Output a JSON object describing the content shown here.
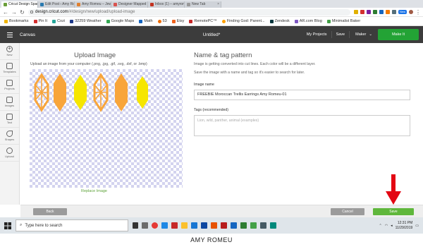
{
  "browser": {
    "tabs": [
      {
        "title": "Cricut Design Space",
        "active": true
      },
      {
        "title": "Edit Post ‹ Amy Romeu"
      },
      {
        "title": "Amy Romeu – Jewelry Ma"
      },
      {
        "title": "Designer Mapped Online"
      },
      {
        "title": "Inbox (1) – amyromeu@g"
      },
      {
        "title": "New Tab"
      }
    ],
    "url_host": "design.cricut.com",
    "url_path": "/#/design/new/upload/upload-image",
    "new_badge": "New",
    "bookmarks": [
      "Bookmarks",
      "Pin It",
      "Cozi",
      "32259 Weather",
      "Google Maps",
      "Math",
      "53",
      "Etsy",
      "RemotePC™",
      "Finding God: Parent...",
      "Zendesk",
      "AR.com Blog",
      "Minimalist Baker"
    ]
  },
  "header": {
    "left_title": "Canvas",
    "doc_title": "Untitled*",
    "my_projects": "My Projects",
    "save": "Save",
    "machine": "Maker",
    "make_it": "Make It"
  },
  "sidebar": [
    {
      "label": "New",
      "icon": "plus-circle-icon"
    },
    {
      "label": "Templates",
      "icon": "shirt-icon"
    },
    {
      "label": "Projects",
      "icon": "grid-icon"
    },
    {
      "label": "Images",
      "icon": "image-icon"
    },
    {
      "label": "Text",
      "icon": "text-icon"
    },
    {
      "label": "Shapes",
      "icon": "shapes-icon"
    },
    {
      "label": "Upload",
      "icon": "upload-icon"
    }
  ],
  "upload": {
    "title": "Upload Image",
    "subtitle": "Upload an image from your computer (.png, .jpg, .gif, .svg, .dxf, or .bmp)",
    "replace": "Replace Image"
  },
  "tag": {
    "title": "Name & tag pattern",
    "desc1": "Image is getting converted into cut lines. Each color will be a different layer.",
    "desc2": "Save the image with a name and tag so it's easier to search for later.",
    "name_label": "Image name",
    "name_value": "FREEBIE Moroccan Trellis Earrings Amy Romeu-01",
    "tags_label": "Tags (recommended)",
    "tags_placeholder": "Lion, wild, panther, animal (examples)"
  },
  "footer": {
    "back": "Back",
    "cancel": "Cancel",
    "save": "Save"
  },
  "taskbar": {
    "search_placeholder": "Type here to search",
    "time": "12:31 PM",
    "date": "11/29/2019"
  },
  "caption": "AMY ROMEU",
  "colors": {
    "header": "#3c3c3c",
    "make_it": "#23a335",
    "save": "#5fb73c",
    "orange": "#f8a53a",
    "yellow": "#f6e600",
    "arrow": "#e30613"
  }
}
